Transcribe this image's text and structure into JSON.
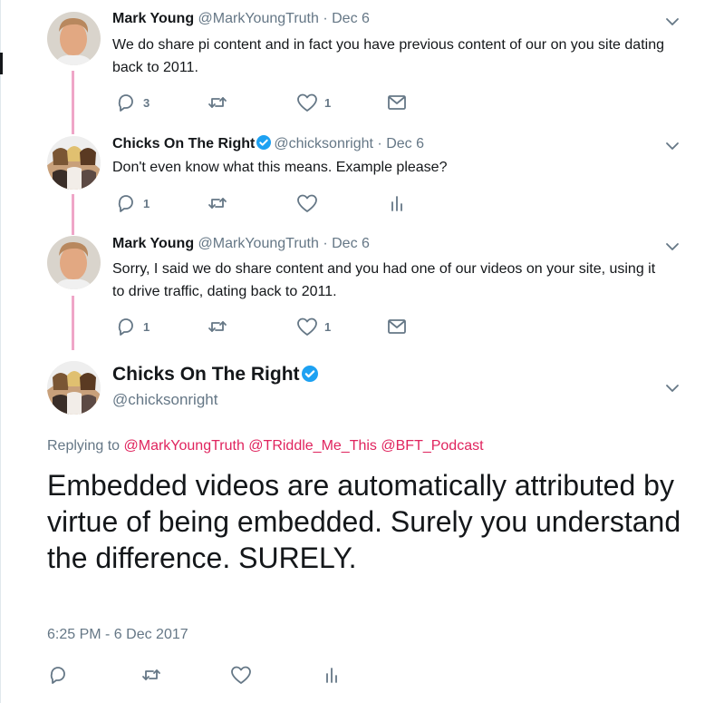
{
  "tweets": [
    {
      "name": "Mark Young",
      "handle": "@MarkYoungTruth",
      "date": "· Dec 6",
      "text": "We do share pi content and in fact you have previous content of our on you site dating back to 2011.",
      "replies": "3",
      "likes": "1",
      "verified": false
    },
    {
      "name": "Chicks On The Right",
      "handle": "@chicksonright",
      "date": "· Dec 6",
      "text": "Don't even know what this means.  Example please?",
      "replies": "1",
      "likes": "",
      "verified": true
    },
    {
      "name": "Mark Young",
      "handle": "@MarkYoungTruth",
      "date": "· Dec 6",
      "text": "Sorry, I said we do share content and you had one of our videos on your site, using it to drive traffic, dating back to 2011.",
      "replies": "1",
      "likes": "1",
      "verified": false
    }
  ],
  "main_tweet": {
    "name": "Chicks On The Right",
    "handle": "@chicksonright",
    "replying_label": "Replying to",
    "replying_to": [
      "@MarkYoungTruth",
      "@TRiddle_Me_This",
      "@BFT_Podcast"
    ],
    "text": "Embedded videos are automatically attributed by virtue of being embedded. Surely you understand the difference. SURELY.",
    "timestamp": "6:25 PM - 6 Dec 2017"
  },
  "icons": [
    "reply-icon",
    "retweet-icon",
    "like-icon",
    "message-icon",
    "analytics-icon",
    "verified-icon",
    "chevron-down-icon"
  ],
  "colors": {
    "thread_line": "#efa6c8",
    "mention": "#e0245e",
    "verified": "#1da1f2",
    "secondary_text": "#657786"
  }
}
